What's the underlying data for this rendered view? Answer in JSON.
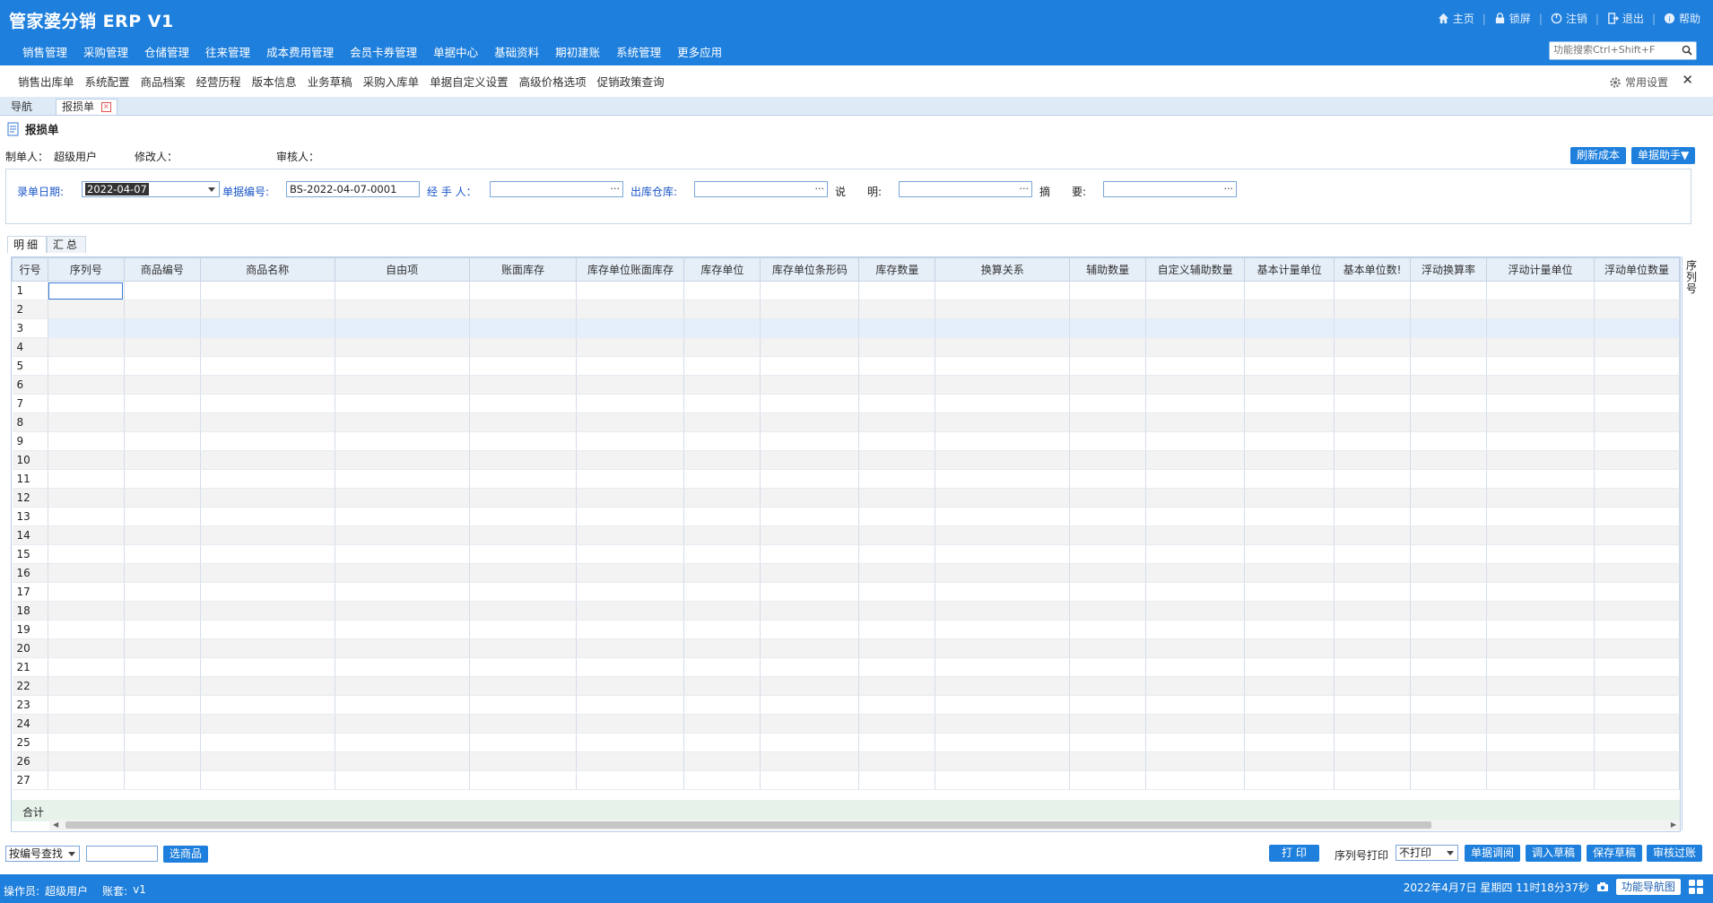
{
  "app": {
    "title": "管家婆分销 ERP V1",
    "top_links": [
      {
        "label": "主页",
        "icon": "home-icon"
      },
      {
        "label": "锁屏",
        "icon": "lock-icon"
      },
      {
        "label": "注销",
        "icon": "logoff-icon"
      },
      {
        "label": "退出",
        "icon": "exit-icon"
      },
      {
        "label": "帮助",
        "icon": "help-icon"
      }
    ],
    "nav": [
      "销售管理",
      "采购管理",
      "仓储管理",
      "往来管理",
      "成本费用管理",
      "会员卡券管理",
      "单据中心",
      "基础资料",
      "期初建账",
      "系统管理",
      "更多应用"
    ],
    "func_search_placeholder": "功能搜索Ctrl+Shift+F",
    "subnav": [
      "销售出库单",
      "系统配置",
      "商品档案",
      "经营历程",
      "版本信息",
      "业务草稿",
      "采购入库单",
      "单据自定义设置",
      "高级价格选项",
      "促销政策查询"
    ],
    "common_settings": "常用设置",
    "close": "✕",
    "accent": "#1e7fdc"
  },
  "tabs": {
    "nav": "导航",
    "active": "报损单"
  },
  "doc": {
    "title": "报损单",
    "creator_label": "制单人：",
    "creator": "超级用户",
    "modifier_label": "修改人：",
    "modifier": "",
    "auditor_label": "审核人：",
    "auditor": "",
    "refresh_cost": "刷新成本",
    "assistant": "单据助手▼"
  },
  "form": {
    "date_label": "录单日期:",
    "date_value": "2022-04-07",
    "number_label": "单据编号:",
    "number_value": "BS-2022-04-07-0001",
    "handler_label": "经 手 人：",
    "handler_value": "",
    "warehouse_label": "出库仓库:",
    "warehouse_value": "",
    "desc_label": "说　　明:",
    "desc_value": "",
    "summary_label": "摘　　要:",
    "summary_value": ""
  },
  "detail_tabs": [
    "明细",
    "汇总"
  ],
  "grid": {
    "columns": [
      "行号",
      "序列号",
      "商品编号",
      "商品名称",
      "自由项",
      "账面库存",
      "库存单位账面库存",
      "库存单位",
      "库存单位条形码",
      "库存数量",
      "换算关系",
      "辅助数量",
      "自定义辅助数量",
      "基本计量单位",
      "基本单位数!",
      "浮动换算率",
      "浮动计量单位",
      "浮动单位数量"
    ],
    "rows": [
      "1",
      "2",
      "3",
      "4",
      "5",
      "6",
      "7",
      "8",
      "9",
      "10",
      "11",
      "12",
      "13",
      "14",
      "15",
      "16",
      "17",
      "18",
      "19",
      "20",
      "21",
      "22",
      "23",
      "24",
      "25",
      "26",
      "27"
    ],
    "total_label": "合计",
    "side_header": "序列号"
  },
  "bottom": {
    "lookup_select": "按编号查找",
    "lookup_value": "",
    "select_goods": "选商品",
    "print": "打 印",
    "serial_print_label": "序列号打印",
    "serial_print_value": "不打印",
    "btn_transfer": "单据调阅",
    "btn_load_draft": "调入草稿",
    "btn_save_draft": "保存草稿",
    "btn_audit": "审核过账"
  },
  "status": {
    "operator_label": "操作员:",
    "operator": "超级用户",
    "account_label": "账套:",
    "account": "v1",
    "datetime": "2022年4月7日  星期四  11时18分37秒",
    "nav_map": "功能导航图"
  }
}
